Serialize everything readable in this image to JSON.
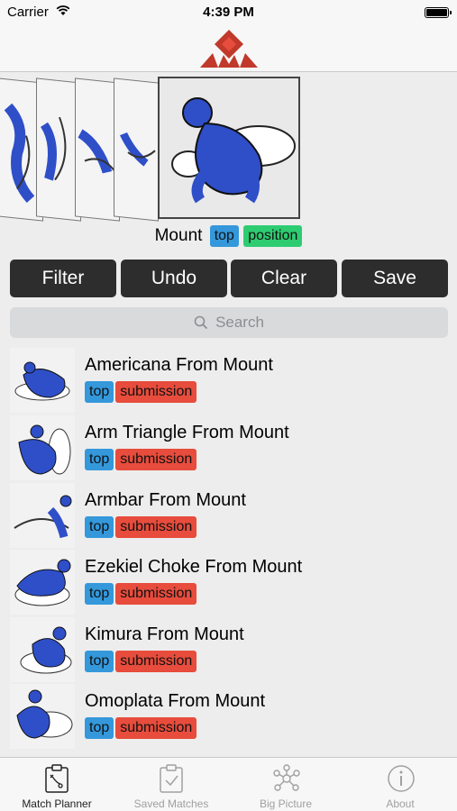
{
  "status_bar": {
    "carrier": "Carrier",
    "time": "4:39 PM"
  },
  "current_position": {
    "name": "Mount",
    "tags": [
      "top",
      "position"
    ]
  },
  "buttons": {
    "filter": "Filter",
    "undo": "Undo",
    "clear": "Clear",
    "save": "Save"
  },
  "search": {
    "placeholder": "Search"
  },
  "techniques": [
    {
      "name": "Americana From Mount",
      "tags": [
        "top",
        "submission"
      ]
    },
    {
      "name": "Arm Triangle From Mount",
      "tags": [
        "top",
        "submission"
      ]
    },
    {
      "name": "Armbar From Mount",
      "tags": [
        "top",
        "submission"
      ]
    },
    {
      "name": "Ezekiel Choke From Mount",
      "tags": [
        "top",
        "submission"
      ]
    },
    {
      "name": "Kimura From Mount",
      "tags": [
        "top",
        "submission"
      ]
    },
    {
      "name": "Omoplata From Mount",
      "tags": [
        "top",
        "submission"
      ]
    }
  ],
  "tabs": [
    {
      "label": "Match Planner",
      "icon": "clipboard-plan-icon",
      "active": true
    },
    {
      "label": "Saved Matches",
      "icon": "clipboard-check-icon",
      "active": false
    },
    {
      "label": "Big Picture",
      "icon": "network-graph-icon",
      "active": false
    },
    {
      "label": "About",
      "icon": "info-icon",
      "active": false
    }
  ],
  "colors": {
    "tag_top": "#3498db",
    "tag_position": "#2ecc71",
    "tag_submission": "#e74c3c",
    "button": "#2d2d2d",
    "brand": "#c0392b",
    "figure_blue": "#2f4fc9"
  }
}
